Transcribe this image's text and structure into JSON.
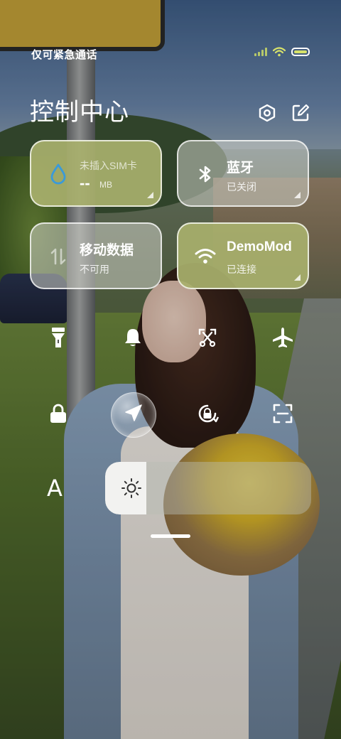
{
  "status_bar": {
    "carrier": "仅可紧急通话",
    "signal_icon": "signal-bars-icon",
    "wifi_icon": "wifi-icon",
    "battery_icon": "battery-icon"
  },
  "header": {
    "title": "控制中心",
    "settings_icon": "settings-hex-icon",
    "edit_icon": "edit-icon"
  },
  "tiles": [
    {
      "label": "未插入SIM卡",
      "value": "--",
      "unit": "MB",
      "icon": "data-drop-icon",
      "style": "olive"
    },
    {
      "label": "蓝牙",
      "sub": "已关闭",
      "icon": "bluetooth-icon",
      "style": "grey"
    },
    {
      "label": "移动数据",
      "sub": "不可用",
      "icon": "mobile-data-icon",
      "style": "grey"
    },
    {
      "label": "DemoMod",
      "sub": "已连接",
      "icon": "wifi-icon",
      "style": "olive"
    }
  ],
  "toggles_row1": [
    "flashlight-icon",
    "bell-icon",
    "screenshot-scissors-icon",
    "airplane-icon"
  ],
  "toggles_row2": [
    "lock-icon",
    "location-icon",
    "auto-rotate-icon",
    "scan-icon"
  ],
  "brightness": {
    "font_size_label": "A",
    "sun_icon": "sun-icon",
    "level": 0.2
  },
  "colors": {
    "tile_olive": "#a8b06c",
    "tile_grey": "#cdcfc6",
    "accent_blue": "#3a9ad9"
  }
}
